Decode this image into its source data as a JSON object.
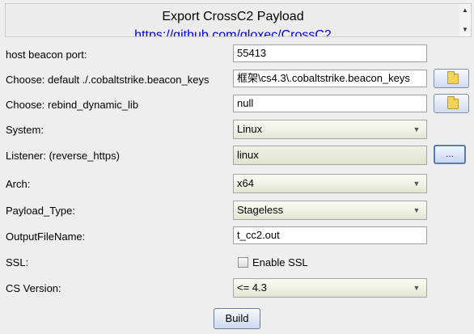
{
  "header": {
    "title": "Export CrossC2 Payload",
    "link": "https://github.com/gloxec/CrossC2"
  },
  "scroll": {
    "up_icon": "scroll-up-arrow",
    "down_icon": "scroll-down-arrow"
  },
  "form": {
    "beacon_port": {
      "label": "host beacon port:",
      "value": "55413"
    },
    "beacon_keys": {
      "label": "Choose: default ./.cobaltstrike.beacon_keys",
      "value": "框架\\cs4.3\\.cobaltstrike.beacon_keys",
      "button_icon": "folder-icon"
    },
    "rebind_lib": {
      "label": "Choose: rebind_dynamic_lib",
      "value": "null",
      "button_icon": "folder-icon"
    },
    "system": {
      "label": "System:",
      "value": "Linux"
    },
    "listener": {
      "label": "Listener: (reverse_https)",
      "value": "linux",
      "button_label": "..."
    },
    "arch": {
      "label": "Arch:",
      "value": "x64"
    },
    "payload_type": {
      "label": "Payload_Type:",
      "value": "Stageless"
    },
    "output_file": {
      "label": "OutputFileName:",
      "value": "t_cc2.out"
    },
    "ssl": {
      "label": "SSL:",
      "checkbox_label": "Enable SSL",
      "checked": false
    },
    "cs_version": {
      "label": "CS Version:",
      "value": "<= 4.3"
    }
  },
  "build_button": "Build"
}
